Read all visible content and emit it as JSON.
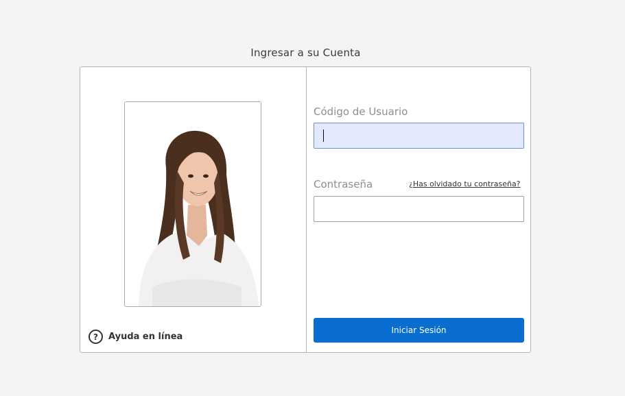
{
  "page": {
    "title": "Ingresar a su Cuenta"
  },
  "left_panel": {
    "photo": {
      "description_icon": "person-photo"
    },
    "help": {
      "icon": "question-circle-icon",
      "label": "Ayuda en línea"
    }
  },
  "form": {
    "username": {
      "label": "Código de Usuario",
      "value": "",
      "focused": true
    },
    "password": {
      "label": "Contraseña",
      "value": ""
    },
    "forgot_link": "¿Has olvidado tu contraseña?",
    "submit_label": "Iniciar Sesión"
  },
  "colors": {
    "primary": "#0a6ed1",
    "focused_input_bg": "#e3e9fd",
    "background": "#f3f4f6"
  }
}
